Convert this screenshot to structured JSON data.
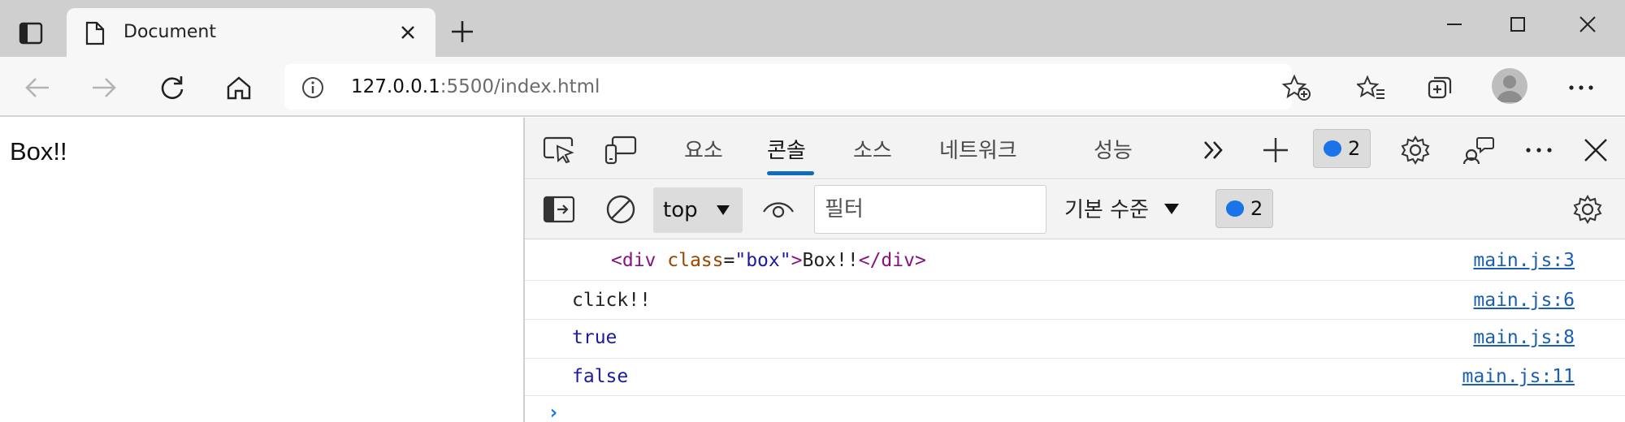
{
  "browser": {
    "tab_title": "Document",
    "url_host": "127.0.0.1",
    "url_rest": ":5500/index.html"
  },
  "page": {
    "text": "Box!!"
  },
  "devtools": {
    "tabs": [
      "요소",
      "콘솔",
      "소스",
      "네트워크",
      "성능"
    ],
    "active_tab": "콘솔",
    "issue_count": "2",
    "console_toolbar": {
      "context": "top",
      "filter_placeholder": "필터",
      "level": "기본 수준",
      "message_count": "2"
    },
    "console": {
      "entries": [
        {
          "tag_open": "<div",
          "attr_name": "class",
          "attr_eq": "=",
          "attr_value": "\"box\"",
          "tag_close": ">",
          "text": "Box!!",
          "tag_end": "</div>",
          "source": "main.js:3"
        },
        {
          "text": "click!!",
          "source": "main.js:6"
        },
        {
          "text": "true",
          "source": "main.js:8"
        },
        {
          "text": "false",
          "source": "main.js:11"
        }
      ],
      "prompt": "›"
    }
  },
  "colors": {
    "accent": "#0f6cbd",
    "link": "#1a5fb4",
    "badge_blue": "#1a73e8"
  }
}
